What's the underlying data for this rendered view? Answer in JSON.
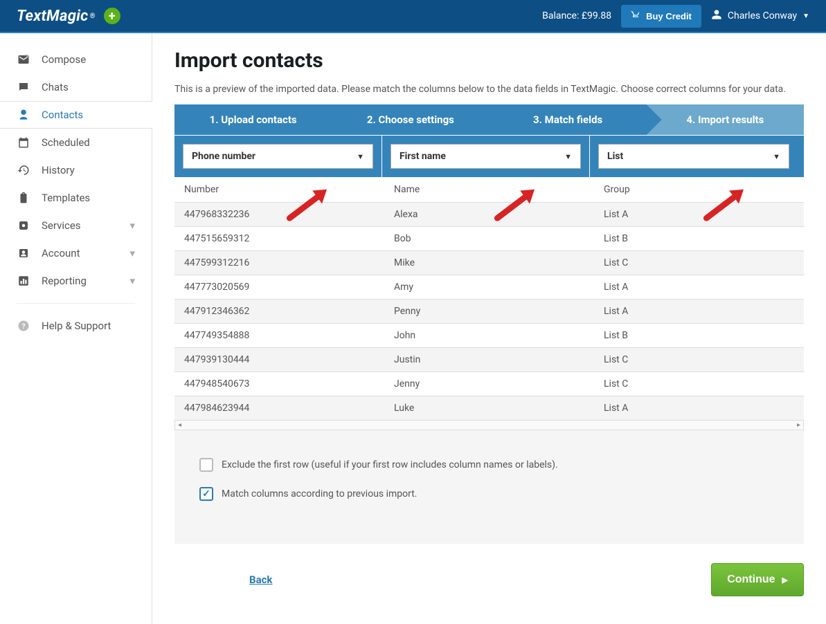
{
  "header": {
    "logo": "TextMagic",
    "balance": "Balance: £99.88",
    "buy_credit": "Buy Credit",
    "user_name": "Charles Conway"
  },
  "sidebar": {
    "items": [
      {
        "label": "Compose",
        "icon": "compose"
      },
      {
        "label": "Chats",
        "icon": "chat"
      },
      {
        "label": "Contacts",
        "icon": "contacts",
        "active": true
      },
      {
        "label": "Scheduled",
        "icon": "calendar"
      },
      {
        "label": "History",
        "icon": "history"
      },
      {
        "label": "Templates",
        "icon": "clipboard"
      },
      {
        "label": "Services",
        "icon": "gear",
        "expandable": true
      },
      {
        "label": "Account",
        "icon": "account",
        "expandable": true
      },
      {
        "label": "Reporting",
        "icon": "bar",
        "expandable": true
      }
    ],
    "help": "Help & Support"
  },
  "page": {
    "title": "Import contacts",
    "subtitle": "This is a preview of the imported data. Please match the columns below to the data fields in TextMagic. Choose correct columns for your data."
  },
  "stepper": [
    "1. Upload contacts",
    "2. Choose settings",
    "3. Match fields",
    "4. Import results"
  ],
  "selects": [
    "Phone number",
    "First name",
    "List"
  ],
  "headers": [
    "Number",
    "Name",
    "Group"
  ],
  "rows": [
    {
      "number": "447968332236",
      "name": "Alexa",
      "group": "List A"
    },
    {
      "number": "447515659312",
      "name": "Bob",
      "group": "List B"
    },
    {
      "number": "447599312216",
      "name": "Mike",
      "group": "List C"
    },
    {
      "number": "447773020569",
      "name": "Amy",
      "group": "List A"
    },
    {
      "number": "447912346362",
      "name": "Penny",
      "group": "List A"
    },
    {
      "number": "447749354888",
      "name": "John",
      "group": "List B"
    },
    {
      "number": "447939130444",
      "name": "Justin",
      "group": "List C"
    },
    {
      "number": "447948540673",
      "name": "Jenny",
      "group": "List C"
    },
    {
      "number": "447984623944",
      "name": "Luke",
      "group": "List A"
    }
  ],
  "options": {
    "exclude_first": "Exclude the first row (useful if your first row includes column names or labels).",
    "match_previous": "Match columns according to previous import."
  },
  "actions": {
    "back": "Back",
    "continue": "Continue"
  }
}
